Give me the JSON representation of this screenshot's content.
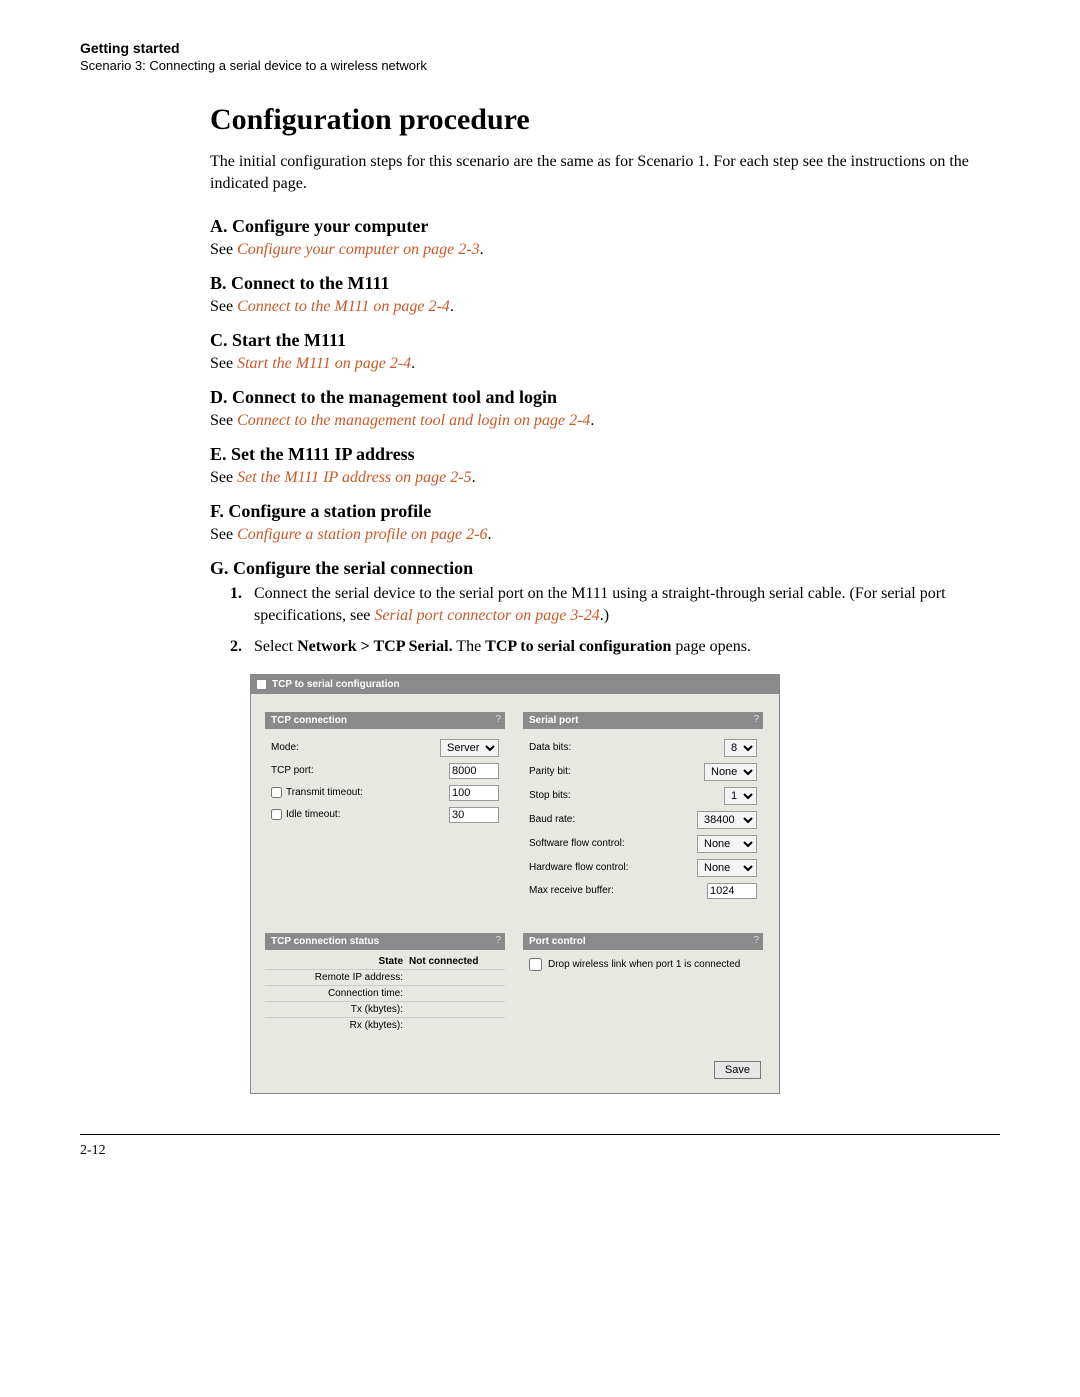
{
  "header": {
    "chapter": "Getting started",
    "scenario": "Scenario 3: Connecting a serial device to a wireless network"
  },
  "title": "Configuration procedure",
  "intro": "The initial configuration steps for this scenario are the same as for Scenario 1. For each step see the instructions on the indicated page.",
  "sections": {
    "A": {
      "heading": "A. Configure your computer",
      "see": "See ",
      "link": "Configure your computer on page 2-3",
      "tail": "."
    },
    "B": {
      "heading": "B. Connect to the M111",
      "see": "See ",
      "link": "Connect to the M111 on page 2-4",
      "tail": "."
    },
    "C": {
      "heading": "C. Start the M111",
      "see": "See ",
      "link": "Start the M111 on page 2-4",
      "tail": "."
    },
    "D": {
      "heading": "D. Connect to the management tool and login",
      "see": "See ",
      "link": "Connect to the management tool and login on page 2-4",
      "tail": "."
    },
    "E": {
      "heading": "E. Set the M111 IP address",
      "see": "See ",
      "link": "Set the M111 IP address on page 2-5",
      "tail": "."
    },
    "F": {
      "heading": "F. Configure a station profile",
      "see": "See ",
      "link": "Configure a station profile on page 2-6",
      "tail": "."
    },
    "G": {
      "heading": "G. Configure the serial connection",
      "step1_a": "Connect the serial device to the serial port on the M111 using a straight-through serial cable. (For serial port specifications, see ",
      "step1_link": "Serial port connector on page 3-24",
      "step1_b": ".)",
      "step2_a": "Select ",
      "step2_bold1": "Network > TCP Serial.",
      "step2_mid": " The ",
      "step2_bold2": "TCP to serial configuration",
      "step2_tail": " page opens."
    }
  },
  "panel": {
    "title": "TCP to serial configuration",
    "tcp_connection": {
      "title": "TCP connection",
      "mode_label": "Mode:",
      "mode_value": "Server",
      "tcp_port_label": "TCP port:",
      "tcp_port_value": "8000",
      "transmit_label": "Transmit timeout:",
      "transmit_value": "100",
      "idle_label": "Idle timeout:",
      "idle_value": "30"
    },
    "serial_port": {
      "title": "Serial port",
      "data_bits_label": "Data bits:",
      "data_bits_value": "8",
      "parity_label": "Parity bit:",
      "parity_value": "None",
      "stop_label": "Stop bits:",
      "stop_value": "1",
      "baud_label": "Baud rate:",
      "baud_value": "38400",
      "swflow_label": "Software flow control:",
      "swflow_value": "None",
      "hwflow_label": "Hardware flow control:",
      "hwflow_value": "None",
      "maxrecv_label": "Max receive buffer:",
      "maxrecv_value": "1024"
    },
    "tcp_status": {
      "title": "TCP connection status",
      "state_label": "State",
      "state_value": "Not connected",
      "remote_ip_label": "Remote IP address:",
      "conn_time_label": "Connection time:",
      "tx_label": "Tx (kbytes):",
      "rx_label": "Rx (kbytes):"
    },
    "port_control": {
      "title": "Port control",
      "drop_label": "Drop wireless link when port 1 is connected"
    },
    "save_label": "Save"
  },
  "page_number": "2-12"
}
